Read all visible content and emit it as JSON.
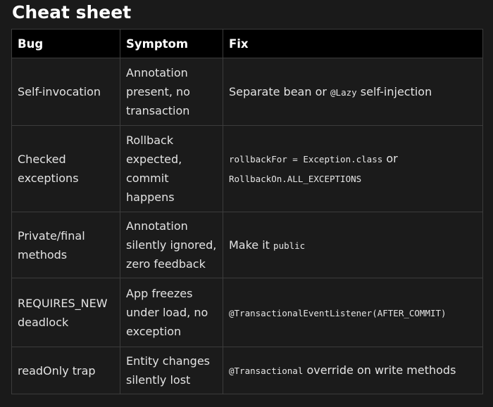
{
  "title": "Cheat sheet",
  "table": {
    "headers": [
      "Bug",
      "Symptom",
      "Fix"
    ],
    "rows": [
      {
        "bug": "Self-invocation",
        "symptom": "Annotation present, no transaction",
        "fix": {
          "text_before": "Separate bean or ",
          "code": "@Lazy",
          "text_after": " self-injection"
        }
      },
      {
        "bug": "Checked exceptions",
        "symptom": "Rollback expected, commit happens",
        "fix": {
          "code1": "rollbackFor = Exception.class",
          "connector": " or",
          "code2": "RollbackOn.ALL_EXCEPTIONS"
        }
      },
      {
        "bug": "Private/final methods",
        "symptom": "Annotation silently ignored, zero feedback",
        "fix": {
          "text_before": "Make it ",
          "code": "public"
        }
      },
      {
        "bug": "REQUIRES_NEW deadlock",
        "symptom": "App freezes under load, no exception",
        "fix": {
          "code": "@TransactionalEventListener(AFTER_COMMIT)"
        }
      },
      {
        "bug": "readOnly trap",
        "symptom": "Entity changes silently lost",
        "fix": {
          "code": "@Transactional",
          "text_after": " override on write methods"
        }
      }
    ]
  }
}
